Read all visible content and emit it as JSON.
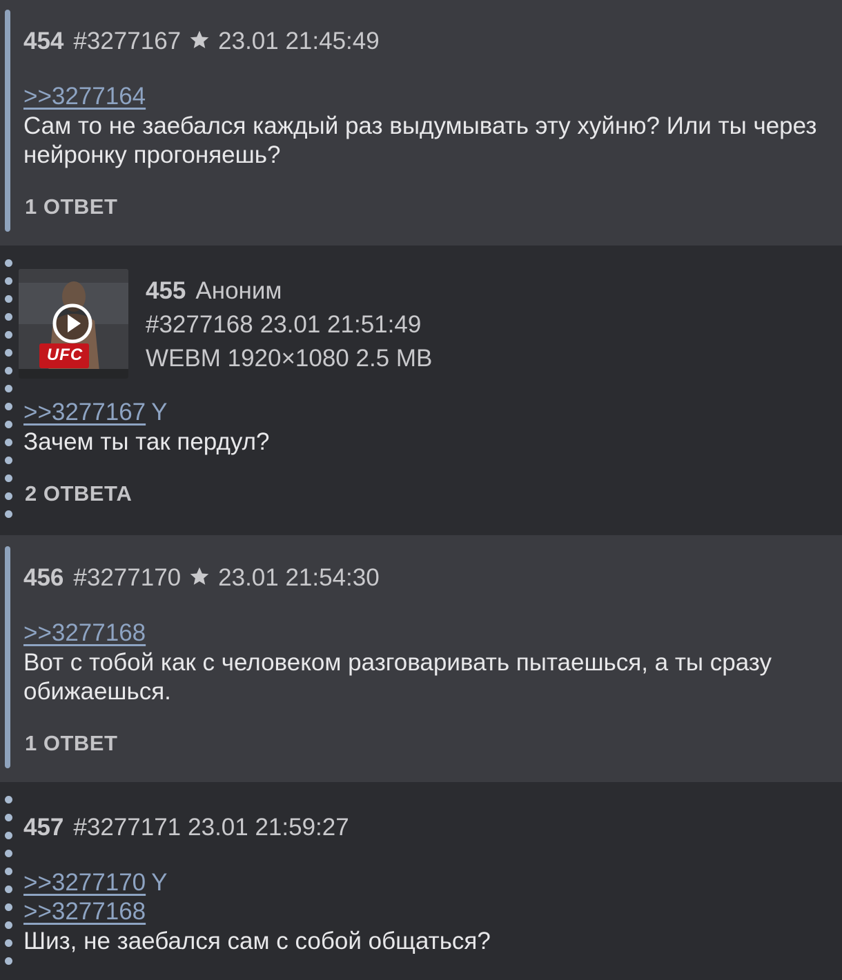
{
  "posts": [
    {
      "number": "454",
      "id": "#3277167",
      "date": "23.01 21:45:49",
      "reply_link": ">>3277164",
      "text": "Сам то не заебался каждый раз выдумывать эту хуйню? Или ты через нейронку прогоняешь?",
      "replies": "1 ОТВЕТ"
    },
    {
      "number": "455",
      "name": "Аноним",
      "id": "#3277168",
      "date": "23.01 21:51:49",
      "file_info": "WEBM 1920×1080 2.5 MB",
      "thumb_text": "UFC",
      "reply_link": ">>3277167",
      "you_marker": "Y",
      "text": "Зачем ты так пердул?",
      "replies": "2 ОТВЕТА"
    },
    {
      "number": "456",
      "id": "#3277170",
      "date": "23.01 21:54:30",
      "reply_link": ">>3277168",
      "text": "Вот с тобой как с человеком разговаривать пытаешься, а ты сразу обижаешься.",
      "replies": "1 ОТВЕТ"
    },
    {
      "number": "457",
      "id": "#3277171",
      "date": "23.01 21:59:27",
      "reply_link_1": ">>3277170",
      "you_marker": "Y",
      "reply_link_2": ">>3277168",
      "text": "Шиз, не заебался сам с собой общаться?"
    }
  ],
  "colors": {
    "accent": "#8ea4c3",
    "own_post_bar": "#8fa3bd",
    "reply_dots": "#a8bad0",
    "post_light_bg": "#3b3c41",
    "post_dark_bg": "#2b2c30"
  },
  "icons": {
    "favorite": "star-icon",
    "video": "play-icon"
  }
}
